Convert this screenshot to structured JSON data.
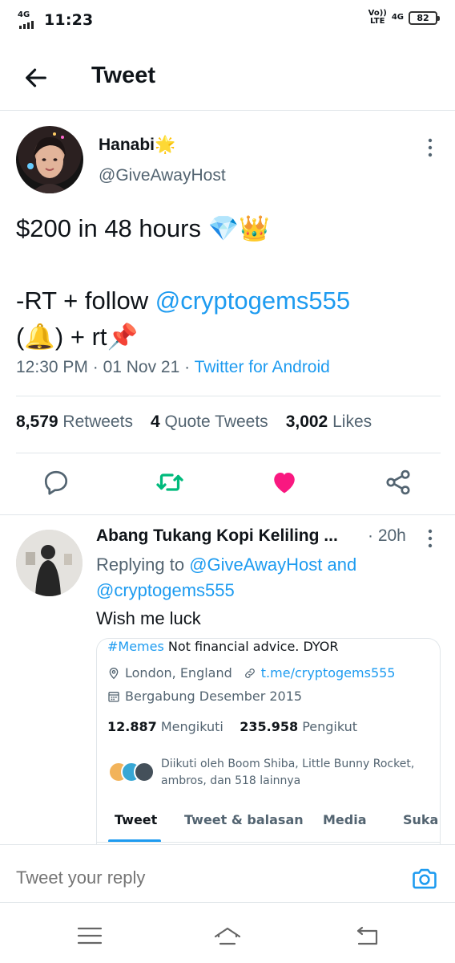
{
  "status_bar": {
    "network": "4G",
    "time": "11:23",
    "volte": "Vo)) LTE",
    "network_right": "4G",
    "battery": "82"
  },
  "header": {
    "title": "Tweet",
    "back_icon": "arrow-left-icon"
  },
  "tweet": {
    "author_name": "Hanabi🌟",
    "author_handle": "@GiveAwayHost",
    "line1": "$200 in 48 hours 💎👑",
    "line2_prefix": "-RT + follow ",
    "mention": "@cryptogems555",
    "line3": "(🔔) + rt📌",
    "time": "12:30 PM",
    "date": "01 Nov 21",
    "source": "Twitter for Android",
    "separator": " · ",
    "retweets_count": "8,579",
    "retweets_label": "Retweets",
    "quotes_count": "4",
    "quotes_label": "Quote Tweets",
    "likes_count": "3,002",
    "likes_label": "Likes",
    "colors": {
      "retweet": "#00ba7c",
      "like": "#f91880",
      "link": "#1d9bf0"
    }
  },
  "reply": {
    "author_name": "Abang Tukang Kopi Keliling ...",
    "time": "· 20h",
    "replying_prefix": "Replying to ",
    "replying_to_1": "@GiveAwayHost",
    "and": " and",
    "replying_to_2": "@cryptogems555",
    "text": "Wish me luck"
  },
  "card": {
    "hashtag": "#Memes",
    "bio_rest": " Not financial advice. DYOR",
    "location": "London, England",
    "link": "t.me/cryptogems555",
    "joined": "Bergabung Desember 2015",
    "following_count": "12.887",
    "following_label": "Mengikuti",
    "followers_count": "235.958",
    "followers_label": "Pengikut",
    "followed_by": "Diikuti oleh Boom Shiba, Little Bunny Rocket, ambros, dan 518 lainnya",
    "tabs": [
      "Tweet",
      "Tweet & balasan",
      "Media",
      "Suka"
    ]
  },
  "reply_box": {
    "placeholder": "Tweet your reply"
  }
}
